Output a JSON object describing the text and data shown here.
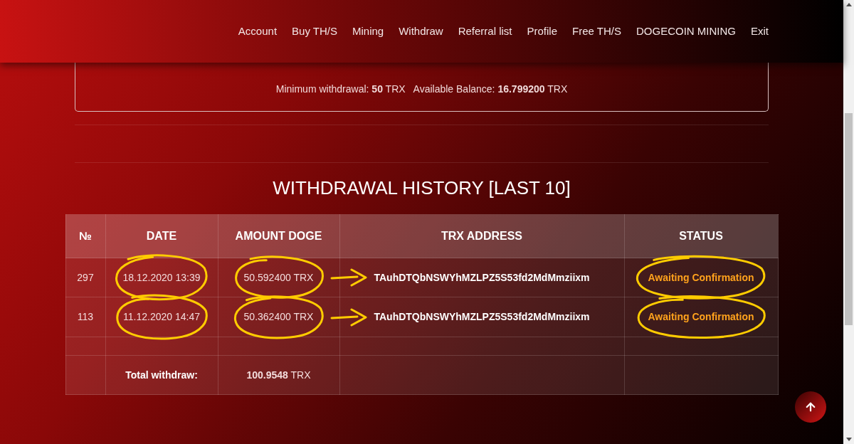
{
  "nav": {
    "items": [
      "Account",
      "Buy TH/S",
      "Mining",
      "Withdraw",
      "Referral list",
      "Profile",
      "Free TH/S",
      "DOGECOIN MINING",
      "Exit"
    ]
  },
  "limits": {
    "minimum": "Minimum withdrawal: **50** TRX",
    "balance": "Available Balance: **16.799200** TRX"
  },
  "history": {
    "title": "WITHDRAWAL HISTORY [LAST 10]",
    "columns": [
      "№",
      "DATE",
      "AMOUNT DOGE",
      "TRX ADDRESS",
      "STATUS"
    ],
    "rows": [
      {
        "number": "297",
        "date": "18.12.2020 13:39",
        "amount": "50.592400 TRX",
        "address": "TAuhDTQbNSWYhMZLPZ5S53fd2MdMmziixm",
        "status": "Awaiting Confirmation",
        "marked": true
      },
      {
        "number": "113",
        "date": "11.12.2020 14:47",
        "amount": "50.362400 TRX",
        "address": "TAuhDTQbNSWYhMZLPZ5S53fd2MdMmziixm",
        "status": "Awaiting Confirmation",
        "marked": true
      }
    ],
    "total": {
      "label": "Total withdraw:",
      "amount": "**100.9548** TRX"
    }
  }
}
